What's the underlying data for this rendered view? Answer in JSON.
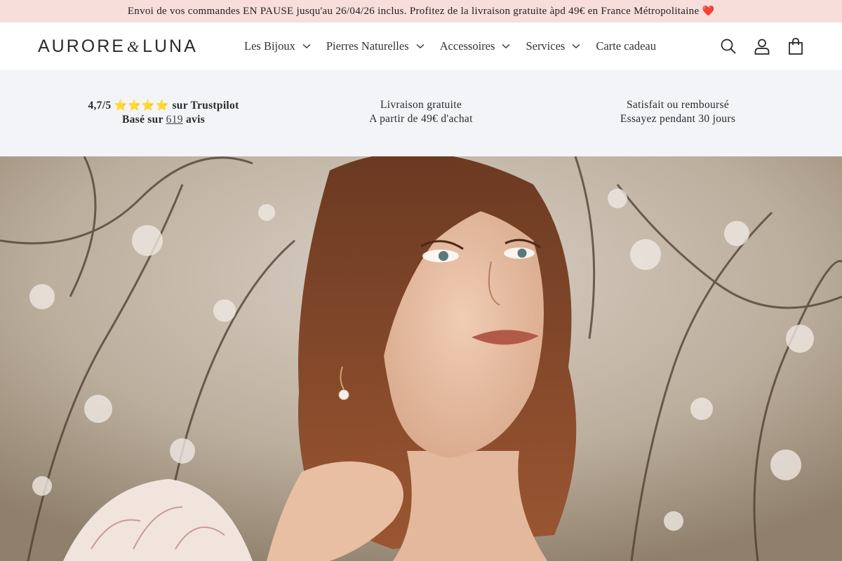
{
  "announcement": {
    "text": "Envoi de vos commandes EN PAUSE jusqu'au 26/04/26 inclus. Profitez de la livraison gratuite àpd 49€ en France Métropolitaine",
    "emoji": "❤️"
  },
  "brand": {
    "part1": "AURORE",
    "amp": "&",
    "part2": "LUNA"
  },
  "nav": {
    "items": [
      {
        "label": "Les Bijoux",
        "has_dropdown": true
      },
      {
        "label": "Pierres Naturelles",
        "has_dropdown": true
      },
      {
        "label": "Accessoires",
        "has_dropdown": true
      },
      {
        "label": "Services",
        "has_dropdown": true
      },
      {
        "label": "Carte cadeau",
        "has_dropdown": false
      }
    ]
  },
  "header_icons": [
    "search-icon",
    "account-icon",
    "cart-icon"
  ],
  "trust": {
    "rating": {
      "score": "4,7/5",
      "stars": "⭐⭐⭐⭐",
      "suffix": "sur Trustpilot",
      "based_prefix": "Basé sur",
      "count": "619",
      "based_suffix": "avis"
    },
    "shipping": {
      "line1": "Livraison gratuite",
      "line2": "A partir de 49€ d'achat"
    },
    "guarantee": {
      "line1": "Satisfait ou remboursé",
      "line2": "Essayez pendant 30 jours"
    }
  },
  "colors": {
    "announcement_bg": "#f7dedb",
    "trust_bg": "#f2f4f7",
    "star": "#f5b301",
    "heart": "#e0393e"
  }
}
